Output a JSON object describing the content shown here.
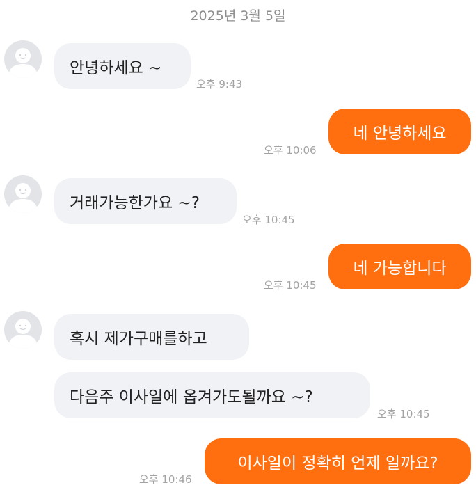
{
  "date_divider": "2025년 3월 5일",
  "messages": [
    {
      "text": "안녕하세요 ~",
      "time": "오후 9:43"
    },
    {
      "text": "네 안녕하세요",
      "time": "오후 10:06"
    },
    {
      "text": "거래가능한가요 ~?",
      "time": "오후 10:45"
    },
    {
      "text": "네 가능합니다",
      "time": "오후 10:45"
    },
    {
      "text": "혹시 제가구매를하고"
    },
    {
      "text": "다음주 이사일에 옵겨가도될까요 ~?",
      "time": "오후 10:45"
    },
    {
      "text": "이사일이 정확히 언제 일까요?",
      "time": "오후 10:46"
    }
  ],
  "colors": {
    "outgoing_bubble": "#ff6f0f",
    "incoming_bubble": "#f1f2f5",
    "timestamp": "#a3a3a3"
  },
  "icons": {
    "avatar": "default-profile-icon"
  }
}
